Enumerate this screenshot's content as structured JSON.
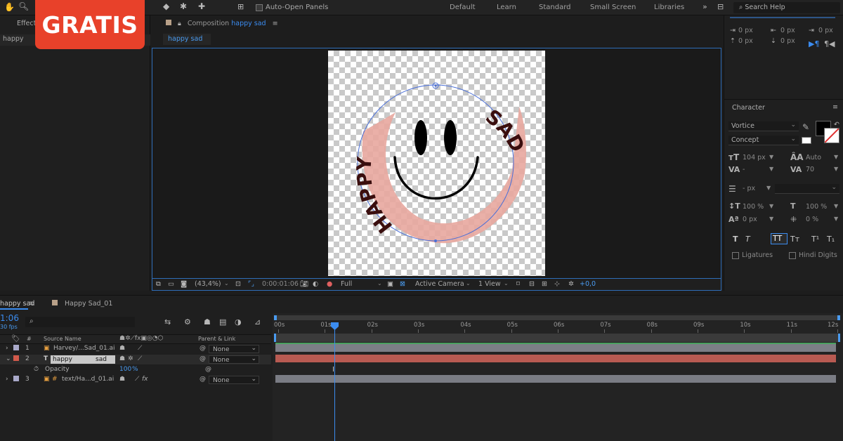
{
  "badge": "GRATIS",
  "toolbar": {
    "auto_open_label": "Auto-Open Panels",
    "workspaces": [
      "Default",
      "Learn",
      "Standard",
      "Small Screen",
      "Libraries"
    ],
    "search_placeholder": "Search Help"
  },
  "left_panel": {
    "tab_label": "Effect",
    "item": "happy"
  },
  "composition": {
    "tab_prefix": "Composition",
    "tab_name": "happy sad",
    "sub_tab": "happy sad",
    "canvas_text_left": "HAPPY",
    "canvas_text_right": "SAD",
    "viewbar": {
      "zoom": "(43,4%)",
      "timecode": "0:00:01:06",
      "resolution": "Full",
      "camera": "Active Camera",
      "view": "1 View",
      "exposure": "+0,0"
    }
  },
  "paragraph": {
    "indent_left": "0 px",
    "indent_first": "0 px",
    "indent_right": "0 px",
    "space_before": "0 px",
    "space_after": "0 px"
  },
  "character": {
    "title": "Character",
    "font_family": "Vortice",
    "font_style": "Concept",
    "font_size": "104 px",
    "leading": "Auto",
    "kerning": "-",
    "tracking": "70",
    "stroke_width": "- px",
    "vertical_scale": "100 %",
    "horizontal_scale": "100 %",
    "baseline_shift": "0 px",
    "tsume": "0 %",
    "style_buttons": [
      "T",
      "T",
      "TT",
      "Tт",
      "T¹",
      "T₁"
    ],
    "ligatures_label": "Ligatures",
    "hindi_digits_label": "Hindi Digits",
    "colors": {
      "fill": "#000000",
      "stroke": "#ffffff"
    }
  },
  "timeline": {
    "tab_active": "happy sad",
    "tab_other": "Happy Sad_01",
    "current_time": "1:06",
    "fps": "30 fps",
    "columns": {
      "num": "#",
      "source": "Source Name",
      "parent": "Parent & Link"
    },
    "ruler": [
      "00s",
      "01s",
      "02s",
      "03s",
      "04s",
      "05s",
      "06s",
      "07s",
      "08s",
      "09s",
      "10s",
      "11s",
      "12s"
    ],
    "layers": [
      {
        "num": "1",
        "name": "Harvey/...Sad_01.ai",
        "parent": "None",
        "color": "#a9a9c9",
        "bar_color": "#7c7e86"
      },
      {
        "num": "2",
        "name": "happy",
        "name2": "sad",
        "parent": "None",
        "color": "#d25a4c",
        "bar_color": "#b85a52"
      },
      {
        "num": "3",
        "name": "text/Ha...d_01.ai",
        "parent": "None",
        "color": "#a9a9c9",
        "bar_color": "#7a7c84"
      }
    ],
    "opacity_label": "Opacity",
    "opacity_value": "100",
    "opacity_unit": "%"
  }
}
